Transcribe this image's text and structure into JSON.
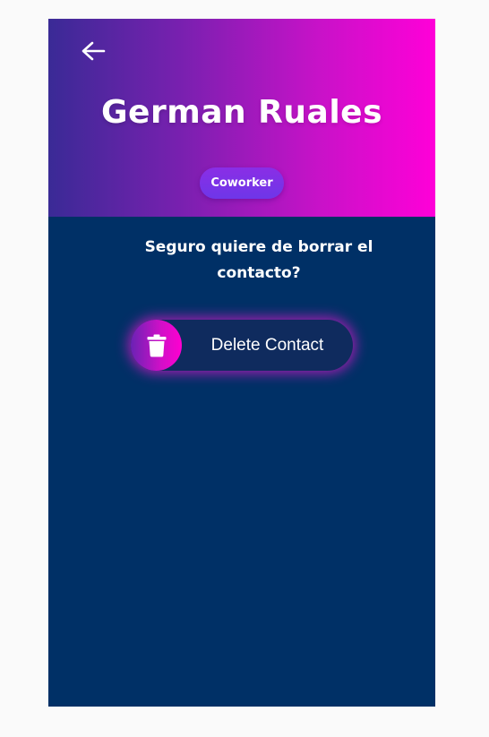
{
  "header": {
    "contact_name": "German Ruales",
    "badge_label": "Coworker",
    "back_icon": "arrow-left-icon"
  },
  "main": {
    "question": "Seguro quiere de borrar el contacto?",
    "delete_button": {
      "label": "Delete Contact",
      "icon": "trash-icon"
    }
  },
  "colors": {
    "background": "#003066",
    "gradient_start": "#3a2a96",
    "gradient_end": "#ff00d8",
    "badge": "#7a33e8",
    "glow": "#d618c8"
  }
}
